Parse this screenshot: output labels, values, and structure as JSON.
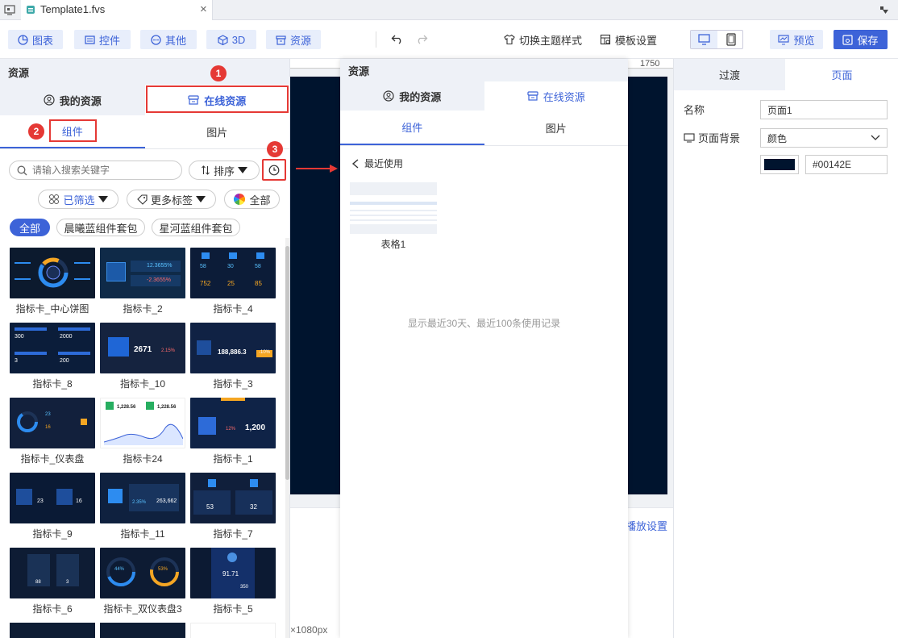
{
  "window": {
    "tab_title": "Template1.fvs",
    "close_glyph": "×"
  },
  "toolbar": {
    "chart_label": "图表",
    "widget_label": "控件",
    "other_label": "其他",
    "threed_label": "3D",
    "resource_label": "资源",
    "theme_label": "切换主题样式",
    "template_settings_label": "模板设置",
    "preview_label": "预览",
    "save_label": "保存"
  },
  "left_panel": {
    "title": "资源",
    "my_resources": "我的资源",
    "online_resources": "在线资源",
    "tab_components": "组件",
    "tab_images": "图片",
    "search_placeholder": "请输入搜索关键字",
    "sort_label": "排序",
    "filter_selected": "已筛选",
    "more_tags": "更多标签",
    "all_colors": "全部",
    "categories": [
      "全部",
      "晨曦蓝组件套包",
      "星河蓝组件套包"
    ],
    "badges": [
      "1",
      "2",
      "3"
    ],
    "cards": [
      {
        "label": "指标卡_中心饼图"
      },
      {
        "label": "指标卡_2"
      },
      {
        "label": "指标卡_4"
      },
      {
        "label": "指标卡_8"
      },
      {
        "label": "指标卡_10"
      },
      {
        "label": "指标卡_3"
      },
      {
        "label": "指标卡_仪表盘"
      },
      {
        "label": "指标卡24"
      },
      {
        "label": "指标卡_1"
      },
      {
        "label": "指标卡_9"
      },
      {
        "label": "指标卡_11"
      },
      {
        "label": "指标卡_7"
      },
      {
        "label": "指标卡_6"
      },
      {
        "label": "指标卡_双仪表盘3"
      },
      {
        "label": "指标卡_5"
      }
    ],
    "thumb_text": {
      "c2a": "12.3655%",
      "c2b": "-2.3655%",
      "c4a": "58",
      "c4b": "30",
      "c4c": "58",
      "c4d": "752",
      "c4e": "25",
      "c4f": "85",
      "c8a": "300",
      "c8b": "2000",
      "c8c": "3",
      "c8d": "200",
      "c10": "2671",
      "c10b": "2.15%",
      "c3": "188,886.3",
      "c3b": "-10%",
      "c24a": "1,228.56",
      "c24b": "1,228.56",
      "c1": "1,200",
      "c1b": "12%",
      "c9a": "23",
      "c9b": "16",
      "c11": "263,662",
      "c11b": "2.35%",
      "c7a": "53",
      "c7b": "32",
      "c6a": "88",
      "c6b": "3",
      "d3a": "44%",
      "d3b": "53%",
      "c5a": "91.71",
      "c5b": "350"
    }
  },
  "canvas": {
    "ruler_mark": "1750",
    "size_label": "×1080px",
    "play_settings": "播放设置"
  },
  "popup": {
    "title": "资源",
    "my_resources": "我的资源",
    "online_resources": "在线资源",
    "tab_components": "组件",
    "tab_images": "图片",
    "recent_label": "最近使用",
    "recent_item": "表格1",
    "hint": "显示最近30天、最近100条使用记录"
  },
  "right_panel": {
    "tab_transition": "过渡",
    "tab_page": "页面",
    "name_label": "名称",
    "name_value": "页面1",
    "bg_label": "页面背景",
    "bg_type": "颜色",
    "bg_color_hex": "#00142E"
  },
  "colors": {
    "accent": "#3d63d8",
    "annotation_red": "#e53935",
    "canvas_bg": "#00142E"
  }
}
